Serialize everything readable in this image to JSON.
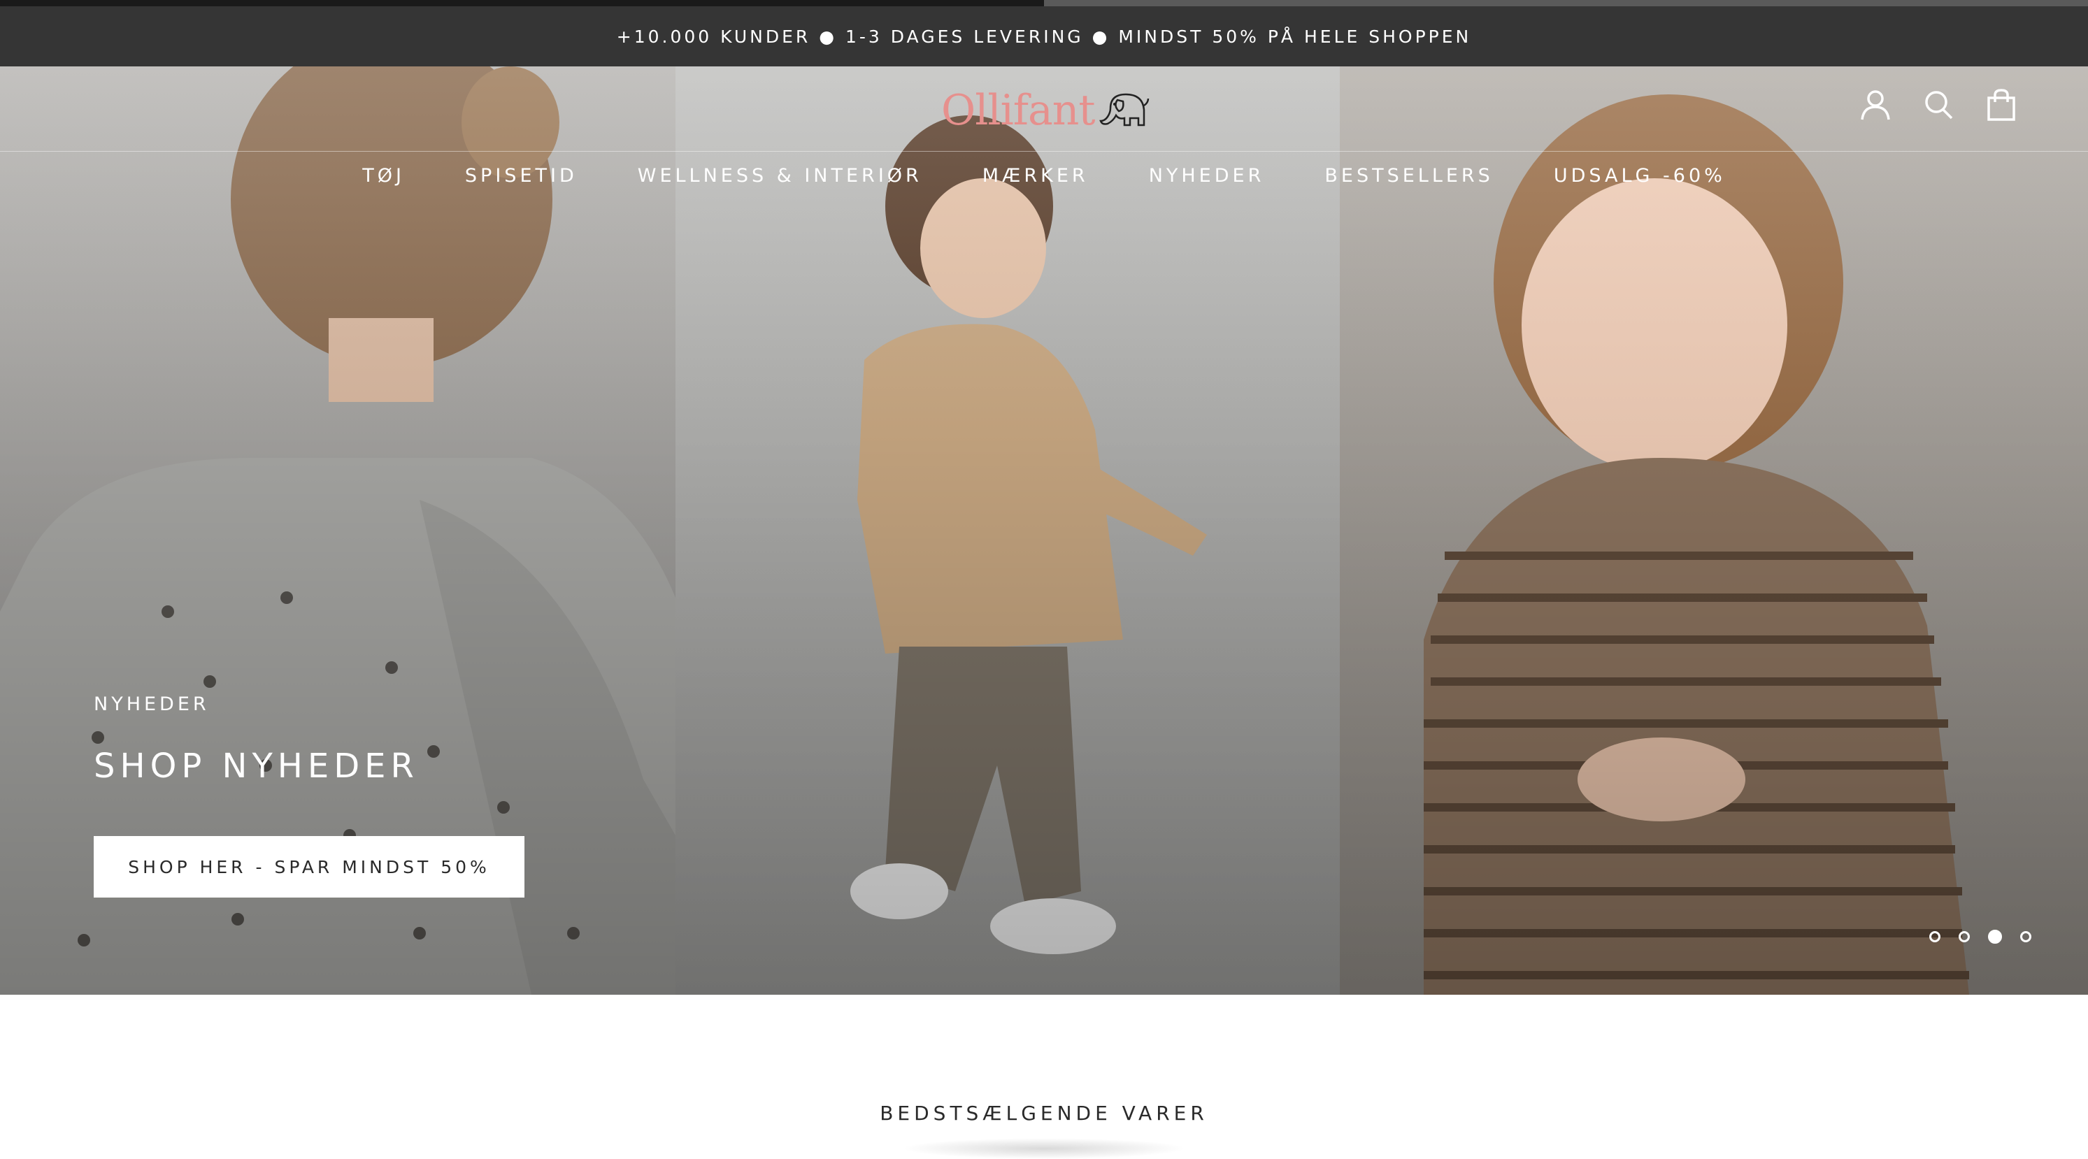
{
  "progress": {
    "fraction": 0.5
  },
  "announcement": {
    "text": "+10.000 KUNDER ● 1-3 DAGES LEVERING ● MINDST 50% PÅ HELE SHOPPEN"
  },
  "header": {
    "logo_text": "Ollifant",
    "logo_icon": "elephant-icon",
    "nav": [
      {
        "label": "TØJ"
      },
      {
        "label": "SPISETID"
      },
      {
        "label": "WELLNESS & INTERIØR"
      },
      {
        "label": "MÆRKER"
      },
      {
        "label": "NYHEDER"
      },
      {
        "label": "BESTSELLERS"
      },
      {
        "label": "UDSALG -60%"
      }
    ],
    "icons": [
      "account-icon",
      "search-icon",
      "shopping-bag-icon"
    ]
  },
  "hero": {
    "eyebrow": "NYHEDER",
    "title": "SHOP NYHEDER",
    "cta_label": "SHOP HER - SPAR MINDST 50%",
    "slide_count": 4,
    "active_slide": 3
  },
  "sections": {
    "bestsellers_title": "BEDSTSÆLGENDE VARER"
  },
  "colors": {
    "announcement_bg": "#353535",
    "logo": "#e6908d",
    "text_dark": "#2a2a2a"
  }
}
